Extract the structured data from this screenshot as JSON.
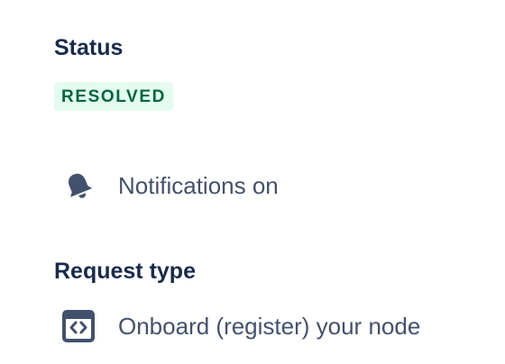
{
  "status": {
    "heading": "Status",
    "value": "RESOLVED",
    "badge_colors": {
      "background": "#e3fcef",
      "text": "#006644"
    }
  },
  "notifications": {
    "label": "Notifications on",
    "icon": "bell-icon"
  },
  "request_type": {
    "heading": "Request type",
    "value": "Onboard (register) your node",
    "icon": "code-brackets-icon"
  },
  "colors": {
    "heading": "#172b4d",
    "body_text": "#42526e",
    "icon": "#42526e"
  }
}
